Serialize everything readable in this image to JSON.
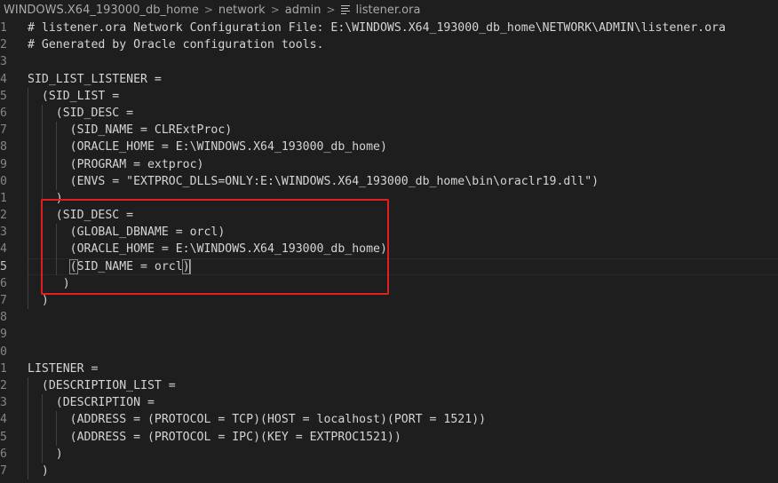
{
  "breadcrumb": {
    "items": [
      "WINDOWS.X64_193000_db_home",
      "network",
      "admin"
    ],
    "file": "listener.ora",
    "separator": ">"
  },
  "editor": {
    "language": "ora",
    "current_line": 15,
    "lines": [
      {
        "n": "1",
        "text": "# listener.ora Network Configuration File: E:\\WINDOWS.X64_193000_db_home\\NETWORK\\ADMIN\\listener.ora"
      },
      {
        "n": "2",
        "text": "# Generated by Oracle configuration tools."
      },
      {
        "n": "3",
        "text": ""
      },
      {
        "n": "4",
        "text": "SID_LIST_LISTENER ="
      },
      {
        "n": "5",
        "text": "  (SID_LIST ="
      },
      {
        "n": "6",
        "text": "    (SID_DESC ="
      },
      {
        "n": "7",
        "text": "      (SID_NAME = CLRExtProc)"
      },
      {
        "n": "8",
        "text": "      (ORACLE_HOME = E:\\WINDOWS.X64_193000_db_home)"
      },
      {
        "n": "9",
        "text": "      (PROGRAM = extproc)"
      },
      {
        "n": "0",
        "text": "      (ENVS = \"EXTPROC_DLLS=ONLY:E:\\WINDOWS.X64_193000_db_home\\bin\\oraclr19.dll\")"
      },
      {
        "n": "1",
        "text": "    )"
      },
      {
        "n": "2",
        "text": "    (SID_DESC ="
      },
      {
        "n": "3",
        "text": "      (GLOBAL_DBNAME = orcl)"
      },
      {
        "n": "4",
        "text": "      (ORACLE_HOME = E:\\WINDOWS.X64_193000_db_home)"
      },
      {
        "n": "5",
        "text": "      (SID_NAME = orcl)"
      },
      {
        "n": "6",
        "text": "     )"
      },
      {
        "n": "7",
        "text": "  )"
      },
      {
        "n": "8",
        "text": ""
      },
      {
        "n": "9",
        "text": ""
      },
      {
        "n": "0",
        "text": ""
      },
      {
        "n": "1",
        "text": "LISTENER ="
      },
      {
        "n": "2",
        "text": "  (DESCRIPTION_LIST ="
      },
      {
        "n": "3",
        "text": "    (DESCRIPTION ="
      },
      {
        "n": "4",
        "text": "      (ADDRESS = (PROTOCOL = TCP)(HOST = localhost)(PORT = 1521))"
      },
      {
        "n": "5",
        "text": "      (ADDRESS = (PROTOCOL = IPC)(KEY = EXTPROC1521))"
      },
      {
        "n": "6",
        "text": "    )"
      },
      {
        "n": "7",
        "text": "  )"
      }
    ]
  },
  "colors": {
    "background": "#1e1e1e",
    "text": "#d4d4d4",
    "line_number": "#858585",
    "highlight_box": "#e01f1f"
  }
}
